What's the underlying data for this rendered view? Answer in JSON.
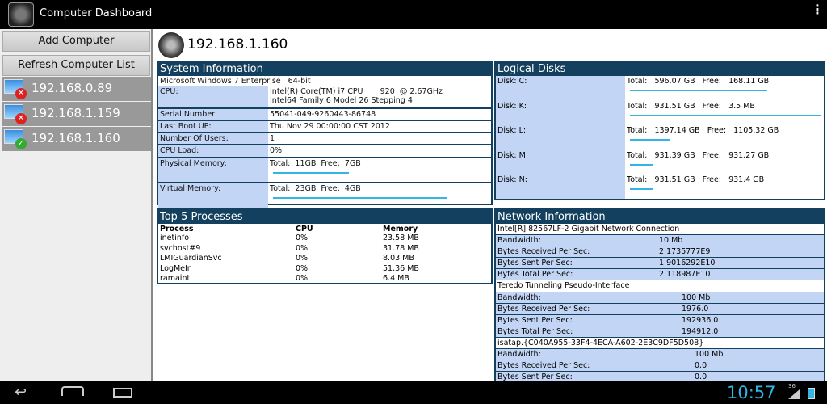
{
  "app": {
    "title": "Computer Dashboard"
  },
  "sidebar": {
    "add_label": "Add Computer",
    "refresh_label": "Refresh Computer List",
    "computers": [
      {
        "ip": "192.168.0.89",
        "status": "offline"
      },
      {
        "ip": "192.168.1.159",
        "status": "offline"
      },
      {
        "ip": "192.168.1.160",
        "status": "online"
      }
    ]
  },
  "selected": {
    "ip": "192.168.1.160"
  },
  "system": {
    "title": "System Information",
    "os": "Microsoft Windows 7 Enterprise   64-bit",
    "rows": [
      {
        "k": "CPU:",
        "v": "Intel(R) Core(TM) i7 CPU       920  @ 2.67GHz",
        "v2": "Intel64 Family 6 Model 26 Stepping 4"
      },
      {
        "k": "Serial Number:",
        "v": "55041-049-9260443-86748"
      },
      {
        "k": "Last Boot UP:",
        "v": "Thu Nov 29 00:00:00 CST 2012"
      },
      {
        "k": "Number Of Users:",
        "v": "1"
      },
      {
        "k": "CPU Load:",
        "v": "0%"
      },
      {
        "k": "Physical Memory:",
        "v": "Total:  11GB  Free:  7GB",
        "used_pct": 36
      },
      {
        "k": "Virtual Memory:",
        "v": "Total:  23GB  Free:  4GB",
        "used_pct": 83
      }
    ]
  },
  "processes": {
    "title": "Top 5 Processes",
    "headers": [
      "Process",
      "CPU",
      "Memory"
    ],
    "rows": [
      [
        "inetinfo",
        "0%",
        "23.58 MB"
      ],
      [
        "svchost#9",
        "0%",
        "31.78 MB"
      ],
      [
        "LMIGuardianSvc",
        "0%",
        "8.03 MB"
      ],
      [
        "LogMeIn",
        "0%",
        "51.36 MB"
      ],
      [
        "ramaint",
        "0%",
        "6.4 MB"
      ]
    ]
  },
  "disks": {
    "title": "Logical Disks",
    "rows": [
      {
        "k": "Disk:  C:",
        "v": "Total:   596.07 GB   Free:   168.11 GB",
        "used_pct": 72
      },
      {
        "k": "Disk:  K:",
        "v": "Total:   931.51 GB   Free:   3.5 MB",
        "used_pct": 100
      },
      {
        "k": "Disk:  L:",
        "v": "Total:   1397.14 GB   Free:   1105.32 GB",
        "used_pct": 21
      },
      {
        "k": "Disk:  M:",
        "v": "Total:   931.39 GB   Free:   931.27 GB",
        "used_pct": 1
      },
      {
        "k": "Disk:  N:",
        "v": "Total:   931.51 GB   Free:   931.4 GB",
        "used_pct": 1
      }
    ]
  },
  "network": {
    "title": "Network Information",
    "adapters": [
      {
        "name": "Intel[R] 82567LF-2 Gigabit Network Connection",
        "rows": [
          [
            "Bandwidth:",
            "10 Mb"
          ],
          [
            "Bytes Received Per Sec:",
            "2.1735777E9"
          ],
          [
            "Bytes Sent Per Sec:",
            "1.9016292E10"
          ],
          [
            "Bytes Total Per Sec:",
            "2.118987E10"
          ]
        ]
      },
      {
        "name": "Teredo Tunneling Pseudo-Interface",
        "rows": [
          [
            "Bandwidth:",
            "100 Mb"
          ],
          [
            "Bytes Received Per Sec:",
            "1976.0"
          ],
          [
            "Bytes Sent Per Sec:",
            "192936.0"
          ],
          [
            "Bytes Total Per Sec:",
            "194912.0"
          ]
        ]
      },
      {
        "name": "isatap.{C040A955-33F4-4ECA-A602-2E3C9DF5D508}",
        "rows": [
          [
            "Bandwidth:",
            "100 Mb"
          ],
          [
            "Bytes Received Per Sec:",
            "0.0"
          ],
          [
            "Bytes Sent Per Sec:",
            "0.0"
          ]
        ]
      }
    ]
  },
  "status": {
    "time": "10:57",
    "signal": "36"
  },
  "colors": {
    "header": "#12405e",
    "label_bg": "#c2d5f4",
    "bar": "#33b5e5"
  }
}
